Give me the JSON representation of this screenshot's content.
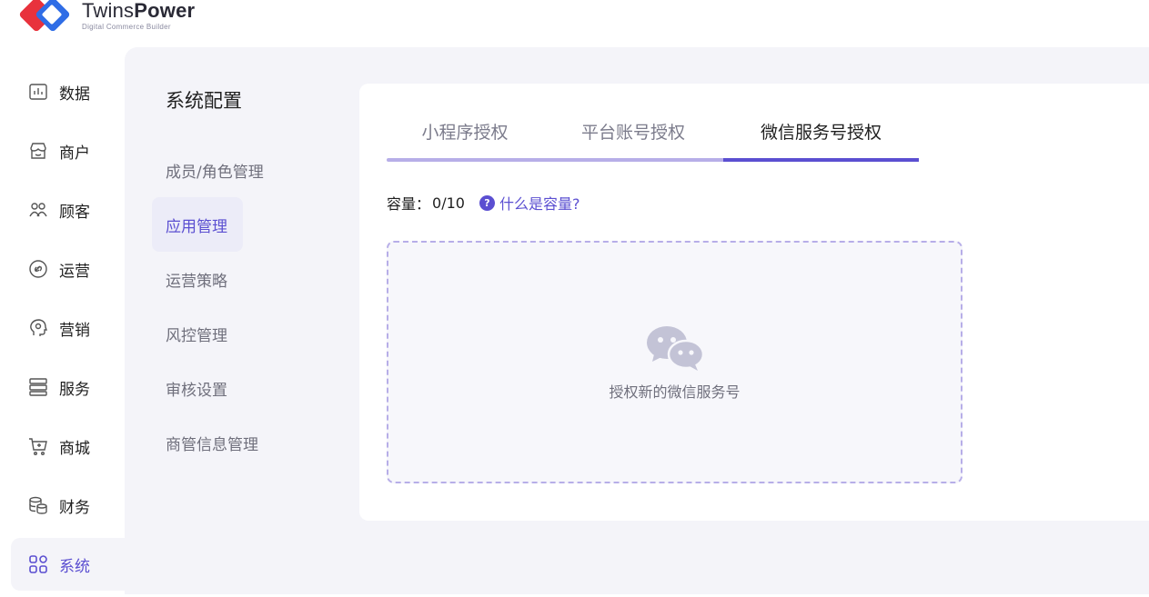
{
  "brand": {
    "name_part1": "Twins",
    "name_part2": "Power",
    "subtitle": "Digital Commerce Builder"
  },
  "main_nav": {
    "items": [
      {
        "label": "数据",
        "icon": "chart-icon"
      },
      {
        "label": "商户",
        "icon": "shop-icon"
      },
      {
        "label": "顾客",
        "icon": "people-icon"
      },
      {
        "label": "运营",
        "icon": "link-icon"
      },
      {
        "label": "营销",
        "icon": "head-icon"
      },
      {
        "label": "服务",
        "icon": "server-icon"
      },
      {
        "label": "商城",
        "icon": "cart-icon"
      },
      {
        "label": "财务",
        "icon": "coins-icon"
      },
      {
        "label": "系统",
        "icon": "grid-icon",
        "active": true
      }
    ]
  },
  "sub_nav": {
    "title": "系统配置",
    "items": [
      {
        "label": "成员/角色管理"
      },
      {
        "label": "应用管理",
        "active": true
      },
      {
        "label": "运营策略"
      },
      {
        "label": "风控管理"
      },
      {
        "label": "审核设置"
      },
      {
        "label": "商管信息管理"
      }
    ]
  },
  "tabs": [
    {
      "label": "小程序授权"
    },
    {
      "label": "平台账号授权"
    },
    {
      "label": "微信服务号授权",
      "active": true
    }
  ],
  "capacity": {
    "label": "容量：",
    "value": "0/10",
    "help_label": "什么是容量?"
  },
  "dropzone": {
    "label": "授权新的微信服务号",
    "icon": "wechat-icon"
  },
  "colors": {
    "accent": "#5b4fd1",
    "accent_light": "#b7aee8",
    "content_bg": "#f4f4f9",
    "logo_red": "#e8323c",
    "logo_blue": "#2f6de6"
  }
}
